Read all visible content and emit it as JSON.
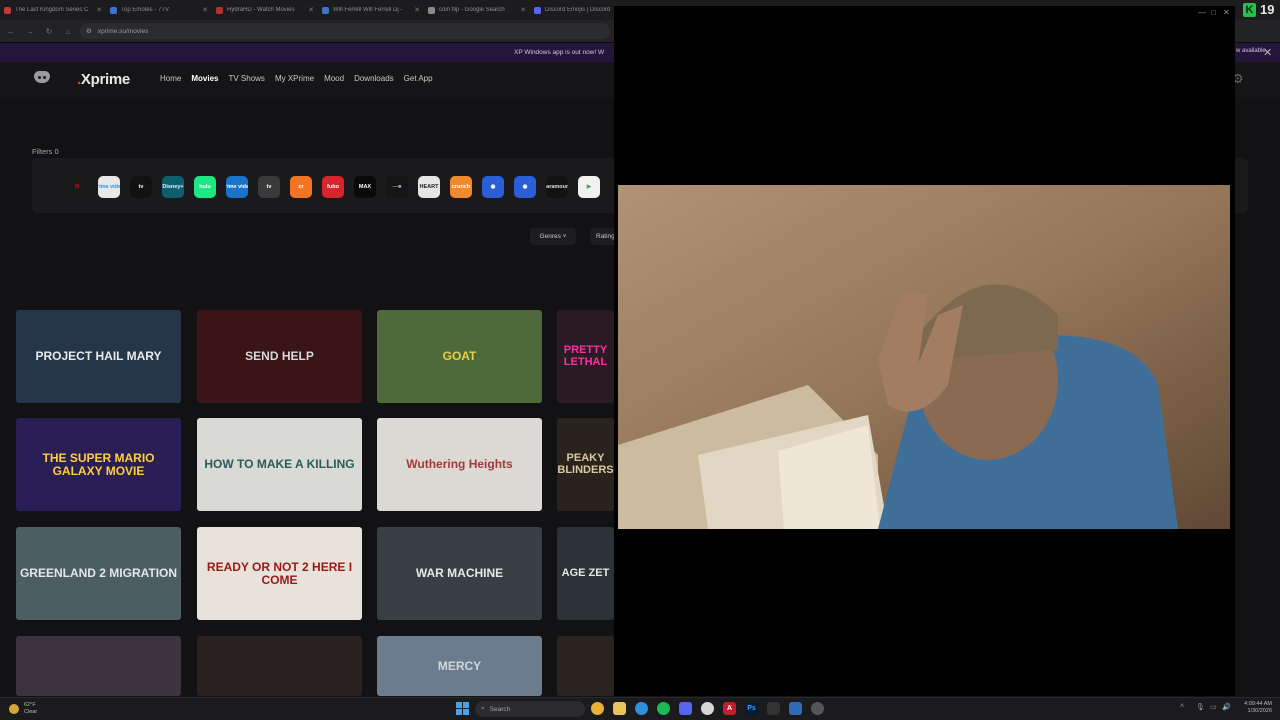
{
  "browser": {
    "tabs": [
      {
        "title": "The Last Kingdom Series C",
        "color": "#c23b3b"
      },
      {
        "title": "Top Emotes - 7TV",
        "color": "#3f6fd1"
      },
      {
        "title": "HydraHD - Watch Movies",
        "color": "#b23030"
      },
      {
        "title": "Will Ferrell Will Ferrell Dj -",
        "color": "#3e73c6"
      },
      {
        "title": "coin flip - Google Search",
        "color": "#8a8a8a"
      },
      {
        "title": "Discord Emojis | Discord",
        "color": "#5865f2"
      }
    ],
    "url": "xprime.su/movies",
    "banner_text": "XP Windows app is out now! W",
    "banner_available": "w available"
  },
  "site": {
    "brand": "Xprime",
    "nav": [
      "Home",
      "Movies",
      "TV Shows",
      "My XPrime",
      "Mood",
      "Downloads",
      "Get App"
    ],
    "active_nav": "Movies",
    "filters_label": "Filters 0",
    "providers": [
      {
        "label": "N",
        "color": "#e50914",
        "bg": "#1a1a1a"
      },
      {
        "label": "prime video",
        "color": "#1a98ff",
        "bg": "#e8e8e8"
      },
      {
        "label": "tv",
        "color": "#ffffff",
        "bg": "#111111"
      },
      {
        "label": "Disney+",
        "color": "#e0f0ff",
        "bg": "#0d5f6e"
      },
      {
        "label": "hulu",
        "color": "#ffffff",
        "bg": "#1ce783"
      },
      {
        "label": "prime video",
        "color": "#ffffff",
        "bg": "#1a73c8"
      },
      {
        "label": "tv",
        "color": "#ffffff",
        "bg": "#3a3a3a"
      },
      {
        "label": "cr",
        "color": "#ffffff",
        "bg": "#f47521"
      },
      {
        "label": "fubo",
        "color": "#ffffff",
        "bg": "#d6262c"
      },
      {
        "label": "MAX",
        "color": "#ffffff",
        "bg": "#0a0a0a"
      },
      {
        "label": "—■",
        "color": "#9ab",
        "bg": "#151515"
      },
      {
        "label": "HEART",
        "color": "#222",
        "bg": "#e6e6e6"
      },
      {
        "label": "crunch",
        "color": "#fff",
        "bg": "#f08a2c"
      },
      {
        "label": "◉",
        "color": "#fff",
        "bg": "#2a5fd6"
      },
      {
        "label": "◉",
        "color": "#fff",
        "bg": "#2a5fd6"
      },
      {
        "label": "paramount",
        "color": "#ddd",
        "bg": "#121212"
      },
      {
        "label": "▶",
        "color": "#34a853",
        "bg": "#f1f1f1"
      }
    ],
    "genres_label": "Genres",
    "genres_caret": "˅",
    "rating_label": "Rating",
    "posters": [
      {
        "title": "PROJECT HAIL MARY",
        "color": "#eaeaea",
        "bg": "#26364a"
      },
      {
        "title": "SEND HELP",
        "color": "#d8d8d8",
        "bg": "#3a1416"
      },
      {
        "title": "GOAT",
        "color": "#e8d04a",
        "bg": "#4e6a3a"
      },
      {
        "title": "PRETTY LETHAL",
        "color": "#ff2fa0",
        "bg": "#2a1a24"
      },
      {
        "title": "THE SUPER MARIO GALAXY MOVIE",
        "color": "#ffcf3a",
        "bg": "#2a1e57"
      },
      {
        "title": "HOW TO MAKE A KILLING",
        "color": "#2b5a5a",
        "bg": "#d9d9d6"
      },
      {
        "title": "Wuthering Heights",
        "color": "#a23a3a",
        "bg": "#dcd8d4"
      },
      {
        "title": "PEAKY BLINDERS",
        "color": "#d9c9a0",
        "bg": "#2a221c"
      },
      {
        "title": "GREENLAND 2 MIGRATION",
        "color": "#e6e6e6",
        "bg": "#4b5e63"
      },
      {
        "title": "READY OR NOT 2 HERE I COME",
        "color": "#9a1818",
        "bg": "#e7e2da"
      },
      {
        "title": "WAR MACHINE",
        "color": "#e6e6e6",
        "bg": "#3a3f44"
      },
      {
        "title": "AGE ZET",
        "color": "#e6e6e6",
        "bg": "#2c3236"
      },
      {
        "title": "",
        "color": "#ddd",
        "bg": "#3b3340"
      },
      {
        "title": "",
        "color": "#ddd",
        "bg": "#2a2020"
      },
      {
        "title": "MERCY",
        "color": "#d0d6dc",
        "bg": "#6a7c8e"
      },
      {
        "title": "",
        "color": "#ddd",
        "bg": "#2a2420"
      }
    ]
  },
  "overlay": {
    "controls": [
      "—",
      "□",
      "✕"
    ]
  },
  "stream": {
    "k_label": "K",
    "count": "19"
  },
  "taskbar": {
    "temp": "62°F",
    "condition": "Clear",
    "search_placeholder": "Search",
    "time": "4:09:44 AM",
    "date": "1/30/2026"
  },
  "colors": {
    "accent": "#e23a3a",
    "kick_green": "#23c24d",
    "banner": "#24163a"
  }
}
